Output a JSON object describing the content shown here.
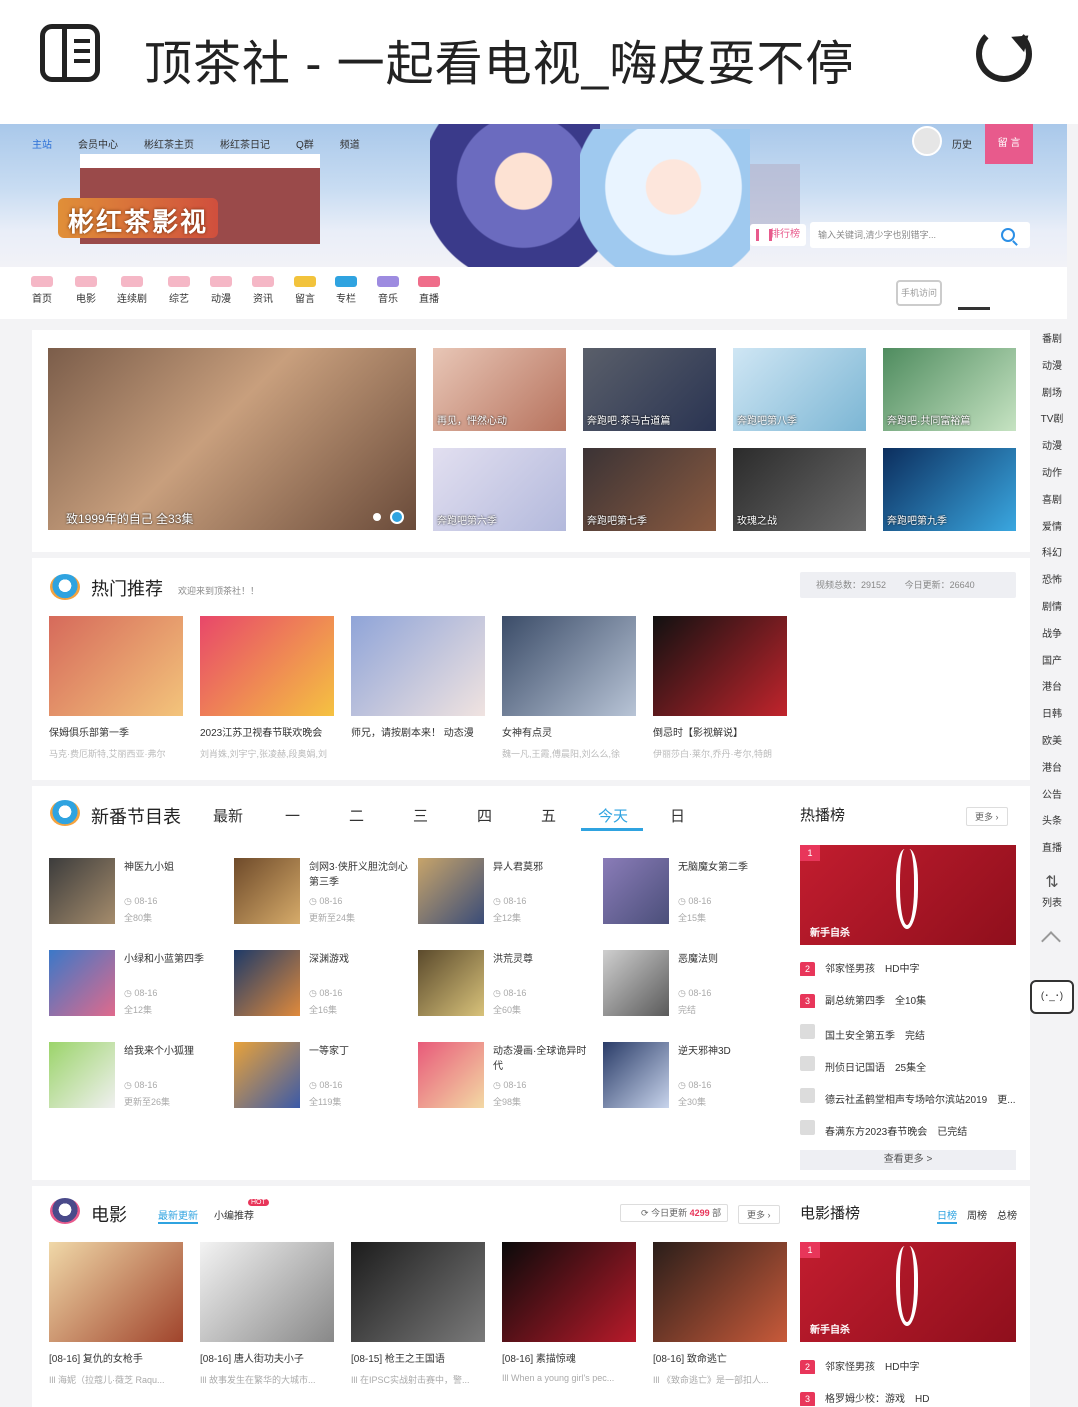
{
  "browser": {
    "title": "顶茶社 - 一起看电视_嗨皮耍不停"
  },
  "topnav": [
    "主站",
    "会员中心",
    "彬红茶主页",
    "彬红茶日记",
    "Q群",
    "频道"
  ],
  "header": {
    "logo": "彬红茶影视",
    "history": "历史",
    "message": "留 言",
    "rank": "排行榜",
    "search_placeholder": "输入关键词,清少字也别错字...",
    "app_button": "手机访问"
  },
  "categories": [
    "首页",
    "电影",
    "连续剧",
    "综艺",
    "动漫",
    "资讯",
    "留言",
    "专栏",
    "音乐",
    "直播"
  ],
  "sidenav": [
    "番剧",
    "动漫",
    "剧场",
    "TV剧",
    "动漫",
    "动作",
    "喜剧",
    "爱情",
    "科幻",
    "恐怖",
    "剧情",
    "战争",
    "国产",
    "港台",
    "日韩",
    "欧美",
    "港台",
    "公告",
    "头条",
    "直播"
  ],
  "sidenav_list": "列表",
  "sidenav_mascot": "(･_･)",
  "hero": {
    "caption": "致1999年的自己 全33集"
  },
  "slides": [
    {
      "label": "再见，怦然心动"
    },
    {
      "label": "奔跑吧·茶马古道篇"
    },
    {
      "label": "奔跑吧第八季"
    },
    {
      "label": "奔跑吧·共同富裕篇"
    },
    {
      "label": "奔跑吧第六季"
    },
    {
      "label": "奔跑吧第七季"
    },
    {
      "label": "玫瑰之战"
    },
    {
      "label": "奔跑吧第九季"
    }
  ],
  "hot": {
    "title": "热门推荐",
    "hint": "欢迎来到顶茶社！！",
    "total_label": "视频总数：",
    "total": "29152",
    "today_label": "今日更新：",
    "today": "26640",
    "items": [
      {
        "title": "保姆俱乐部第一季",
        "sub": "马克·费厄斯特,艾丽西亚·弗尔"
      },
      {
        "title": "2023江苏卫视春节联欢晚会",
        "sub": "刘肖姝,刘宇宁,张凌赫,段奥娟,刘"
      },
      {
        "title": "师兄，请按剧本来！ 动态漫",
        "sub": ""
      },
      {
        "title": "女神有点灵",
        "sub": "魏一凡,王霞,傅晨阳,刘么么,徐"
      },
      {
        "title": "倒忌时【影视解说】",
        "sub": "伊丽莎白·莱尔,乔丹·考尔,特朗"
      }
    ]
  },
  "schedule": {
    "title": "新番节目表",
    "days": [
      "最新",
      "一",
      "二",
      "三",
      "四",
      "五",
      "今天",
      "日"
    ],
    "items": [
      {
        "title": "神医九小姐",
        "date": "08-16",
        "ep": "全80集"
      },
      {
        "title": "剑网3·侠肝义胆沈剑心第三季",
        "date": "08-16",
        "ep": "更新至24集"
      },
      {
        "title": "异人君莫邪",
        "date": "08-16",
        "ep": "全12集"
      },
      {
        "title": "无脑魔女第二季",
        "date": "08-16",
        "ep": "全15集"
      },
      {
        "title": "小绿和小蓝第四季",
        "date": "08-16",
        "ep": "全12集"
      },
      {
        "title": "深渊游戏",
        "date": "08-16",
        "ep": "全16集"
      },
      {
        "title": "洪荒灵尊",
        "date": "08-16",
        "ep": "全60集"
      },
      {
        "title": "恶魔法则",
        "date": "08-16",
        "ep": "完结"
      },
      {
        "title": "给我来个小狐狸",
        "date": "08-16",
        "ep": "更新至26集"
      },
      {
        "title": "一等家丁",
        "date": "08-16",
        "ep": "全119集"
      },
      {
        "title": "动态漫画·全球诡异时代",
        "date": "08-16",
        "ep": "全98集"
      },
      {
        "title": "逆天邪神3D",
        "date": "08-16",
        "ep": "全30集"
      }
    ]
  },
  "hotlist": {
    "title": "热播榜",
    "more": "更多",
    "top": {
      "rank": "1",
      "title": "新手自杀"
    },
    "rows": [
      {
        "rank": "2",
        "title": "邻家怪男孩",
        "note": "HD中字"
      },
      {
        "rank": "3",
        "title": "副总统第四季",
        "note": "全10集"
      },
      {
        "rank": "",
        "title": "国土安全第五季",
        "note": "完结"
      },
      {
        "rank": "",
        "title": "刑侦日记国语",
        "note": "25集全"
      },
      {
        "rank": "",
        "title": "德云社孟鹤堂相声专场哈尔滨站2019",
        "note": "更..."
      },
      {
        "rank": "",
        "title": "春满东方2023春节晚会",
        "note": "已完结"
      }
    ],
    "see_all": "查看更多 >"
  },
  "movies": {
    "title": "电影",
    "tab_latest": "最新更新",
    "tab_editor": "小编推荐",
    "hot_badge": "HOT",
    "update_label": "今日更新",
    "update_count": "4299",
    "update_unit": "部",
    "more": "更多",
    "items": [
      {
        "title": "[08-16] 复仇的女枪手",
        "sub": "Ill 海妮（拉蔻儿·薇芝 Raqu..."
      },
      {
        "title": "[08-16] 唐人街功夫小子",
        "sub": "Ill 故事发生在繁华的大城市..."
      },
      {
        "title": "[08-15] 枪王之王国语",
        "sub": "Ill 在IPSC实战射击赛中，警..."
      },
      {
        "title": "[08-16] 素描惊魂",
        "sub": "Ill When a young girl's pec..."
      },
      {
        "title": "[08-16] 致命逃亡",
        "sub": "Ill 《致命逃亡》是一部扣人..."
      }
    ]
  },
  "movie_rank": {
    "title": "电影播榜",
    "tabs": [
      "日榜",
      "周榜",
      "总榜"
    ],
    "top": {
      "rank": "1",
      "title": "新手自杀"
    },
    "rows": [
      {
        "rank": "2",
        "title": "邻家怪男孩",
        "note": "HD中字"
      },
      {
        "rank": "3",
        "title": "格罗姆少校：游戏",
        "note": "HD"
      }
    ]
  },
  "colors": {
    "accent": "#2fa3e0",
    "pink": "#e85a8c",
    "rank_red": "#e8365a"
  }
}
